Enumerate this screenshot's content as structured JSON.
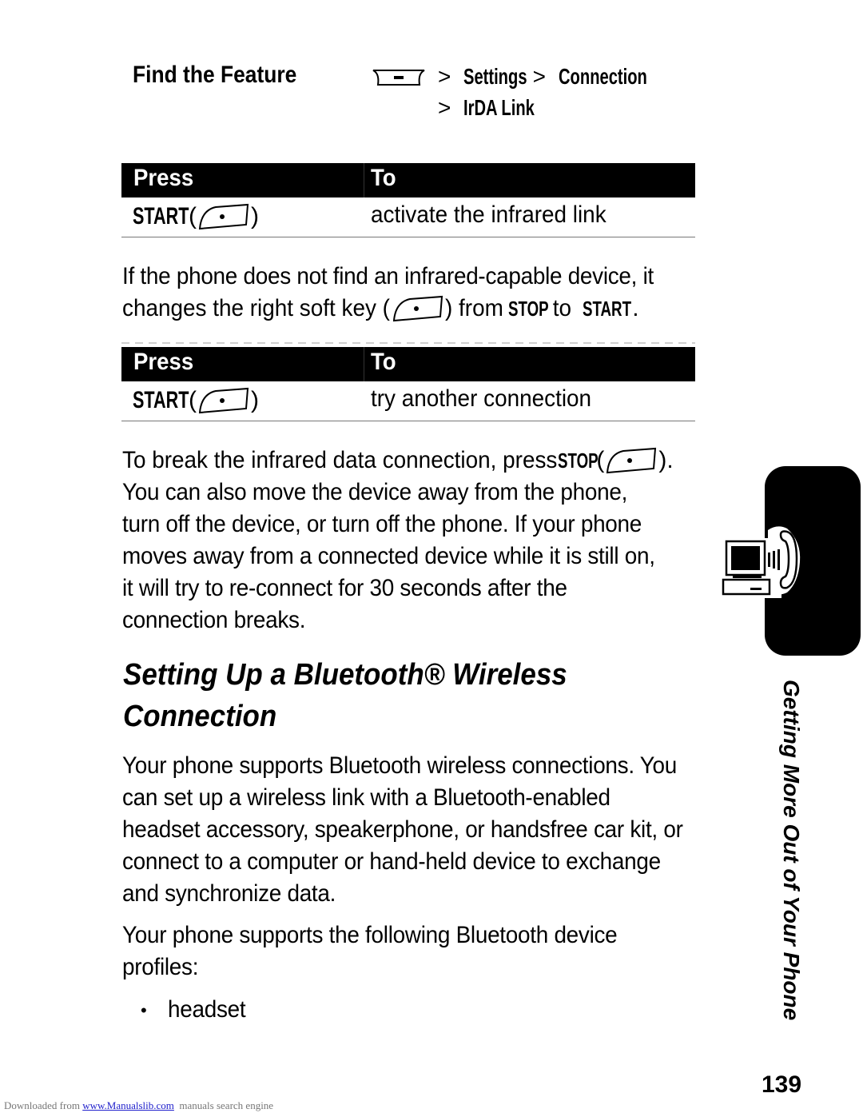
{
  "find_feature": {
    "label": "Find the Feature",
    "menu_key_icon": "menu-key-icon",
    "path_line1": [
      "Settings",
      "Connection"
    ],
    "path_line2": [
      "IrDA Link"
    ],
    "separator": ">"
  },
  "table1": {
    "headers": [
      "Press",
      "To"
    ],
    "rows": [
      {
        "key": "START",
        "key_icon": "right-soft-key-icon",
        "action": "activate the infrared link"
      }
    ]
  },
  "para1": {
    "line1": "If the phone does not find an infrared-capable device, it",
    "line2_a": "changes the right soft key (",
    "line2_b": ") from ",
    "stop": "STOP",
    "to": " to ",
    "start": "START",
    "end": "."
  },
  "table2": {
    "headers": [
      "Press",
      "To"
    ],
    "rows": [
      {
        "key": "START",
        "key_icon": "right-soft-key-icon",
        "action": "try another connection"
      }
    ]
  },
  "para2": {
    "line1_a": "To break the infrared data connection, press ",
    "stop": "STOP",
    "line1_b": " (",
    "line1_c": ").",
    "lines": [
      "You can also move the device away from the phone,",
      "turn off the device, or turn off the phone. If your phone",
      "moves away from a connected device while it is still on,",
      "it will try to re-connect for 30 seconds after the",
      "connection breaks."
    ]
  },
  "section": {
    "heading_line1": "Setting Up a Bluetooth® Wireless",
    "heading_line2": "Connection",
    "para3_lines": [
      "Your phone supports Bluetooth wireless connections. You",
      "can set up a wireless link with a Bluetooth-enabled",
      "headset accessory, speakerphone, or handsfree car kit, or",
      "connect to a computer or hand-held device to exchange",
      "and synchronize data."
    ],
    "para4_lines": [
      "Your phone supports the following Bluetooth device",
      "profiles:"
    ],
    "bullets": [
      "headset"
    ]
  },
  "sidebar": {
    "chapter_title": "Getting More Out of Your Phone",
    "icon": "computer-phone-connection-icon"
  },
  "page_number": "139",
  "footer": {
    "prefix": "Downloaded from ",
    "link": "www.Manualslib.com",
    "suffix": "  manuals search engine",
    "link_color": "#2020cc"
  }
}
